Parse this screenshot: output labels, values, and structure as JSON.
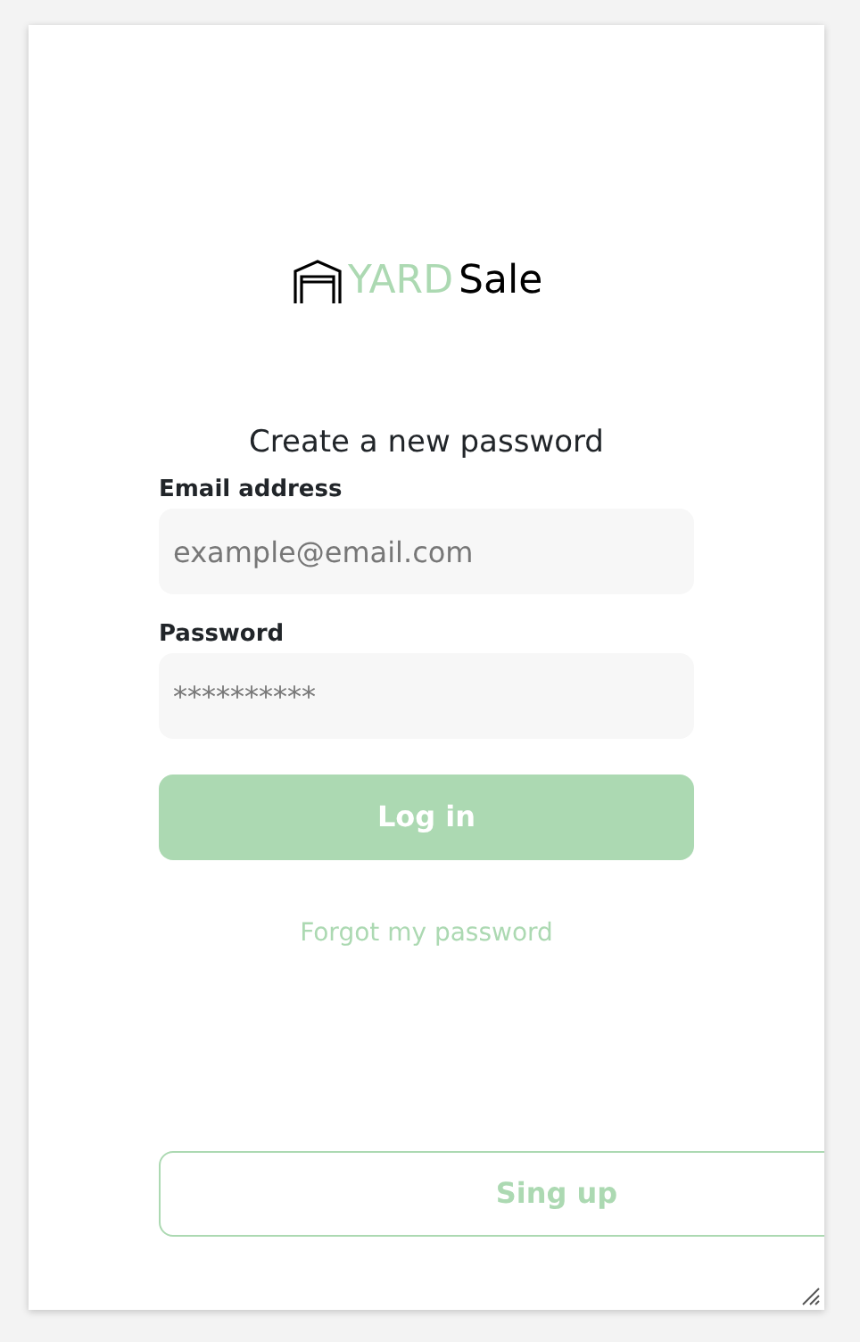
{
  "logo": {
    "accent": "YARD",
    "name": "Sale"
  },
  "title": "Create a new password",
  "fields": [
    {
      "label": "Email address",
      "placeholder": "example@email.com"
    },
    {
      "label": "Password",
      "placeholder": "**********"
    }
  ],
  "login_button": {
    "label": "Log in",
    "disabled": true
  },
  "forgot_link": "Forgot my password",
  "signup_button": "Sing up"
}
